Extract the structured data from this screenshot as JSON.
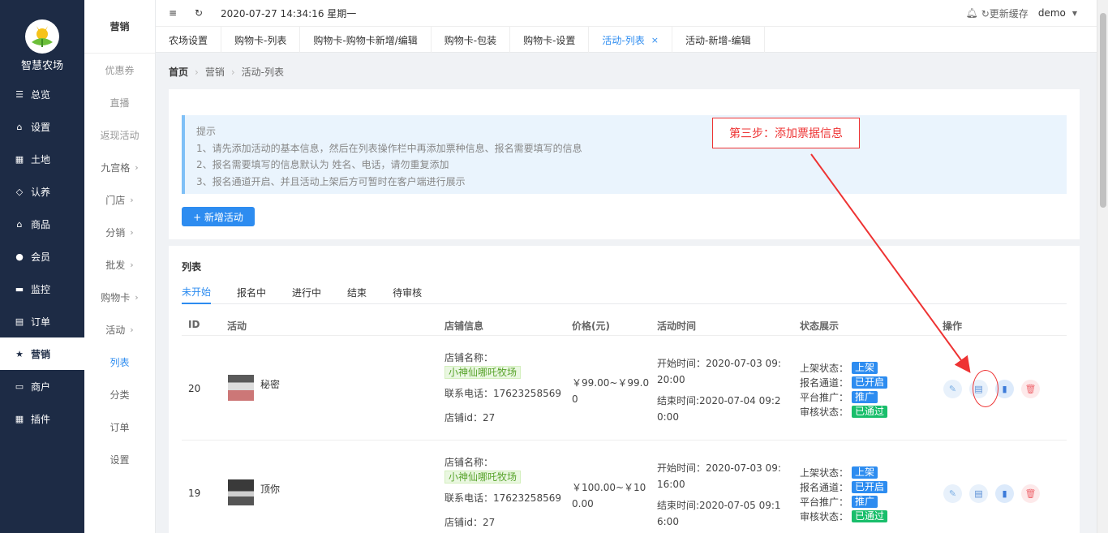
{
  "app": {
    "name": "智慧农场"
  },
  "sidebar": {
    "items": [
      {
        "label": "总览",
        "icon": "sliders-icon"
      },
      {
        "label": "设置",
        "icon": "bag-icon"
      },
      {
        "label": "土地",
        "icon": "grid-icon"
      },
      {
        "label": "认养",
        "icon": "diamond-icon"
      },
      {
        "label": "商品",
        "icon": "bag-icon"
      },
      {
        "label": "会员",
        "icon": "user-icon"
      },
      {
        "label": "监控",
        "icon": "camera-icon"
      },
      {
        "label": "订单",
        "icon": "clipboard-icon"
      },
      {
        "label": "营销",
        "icon": "star-icon",
        "active": true
      },
      {
        "label": "商户",
        "icon": "store-icon"
      },
      {
        "label": "插件",
        "icon": "grid-icon"
      }
    ]
  },
  "submenu": {
    "title": "营销",
    "items": [
      {
        "label": "优惠券",
        "muted": true
      },
      {
        "label": "直播",
        "muted": true
      },
      {
        "label": "返现活动",
        "muted": true
      },
      {
        "label": "九宫格",
        "arrow": true
      },
      {
        "label": "门店",
        "arrow": true
      },
      {
        "label": "分销",
        "arrow": true
      },
      {
        "label": "批发",
        "arrow": true
      },
      {
        "label": "购物卡",
        "arrow": true
      },
      {
        "label": "活动",
        "arrow": true
      },
      {
        "label": "列表",
        "active": true
      },
      {
        "label": "分类"
      },
      {
        "label": "订单"
      },
      {
        "label": "设置"
      }
    ]
  },
  "header": {
    "datetime": "2020-07-27 14:34:16 星期一",
    "refresh_cache": "更新缓存",
    "user": "demo"
  },
  "tabs": [
    {
      "label": "农场设置"
    },
    {
      "label": "购物卡-列表"
    },
    {
      "label": "购物卡-购物卡新增/编辑"
    },
    {
      "label": "购物卡-包装"
    },
    {
      "label": "购物卡-设置"
    },
    {
      "label": "活动-列表",
      "active": true,
      "close": "×"
    },
    {
      "label": "活动-新增-编辑"
    }
  ],
  "breadcrumb": {
    "home": "首页",
    "level1": "营销",
    "level2": "活动-列表"
  },
  "tip": {
    "title": "提示",
    "lines": [
      "1、请先添加活动的基本信息，然后在列表操作栏中再添加票种信息、报名需要填写的信息",
      "2、报名需要填写的信息默认为 姓名、电话，请勿重复添加",
      "3、报名通道开启、并且活动上架后方可暂时在客户端进行展示"
    ]
  },
  "add_button": "+ 新增活动",
  "annotation": "第三步：添加票据信息",
  "list": {
    "title": "列表",
    "status_tabs": [
      "未开始",
      "报名中",
      "进行中",
      "结束",
      "待审核"
    ],
    "columns": [
      "ID",
      "活动",
      "店铺信息",
      "价格(元)",
      "活动时间",
      "状态展示",
      "操作"
    ],
    "rows": [
      {
        "id": "20",
        "name": "秘密",
        "shop_name_label": "店铺名称：",
        "shop_name": "小神仙哪吒牧场",
        "phone": "联系电话：17623258569",
        "shop_id": "店铺id：27",
        "price": "￥99.00~￥99.00",
        "start": "开始时间：2020-07-03 09:20:00",
        "end": "结束时间:2020-07-04 09:20:00",
        "status": [
          {
            "label": "上架状态：",
            "value": "上架",
            "color": "#2d8cf0"
          },
          {
            "label": "报名通道：",
            "value": "已开启",
            "color": "#2d8cf0"
          },
          {
            "label": "平台推广：",
            "value": "推广",
            "color": "#2d8cf0"
          },
          {
            "label": "审核状态：",
            "value": "已通过",
            "color": "#19be6b"
          }
        ]
      },
      {
        "id": "19",
        "name": "顶你",
        "shop_name_label": "店铺名称：",
        "shop_name": "小神仙哪吒牧场",
        "phone": "联系电话：17623258569",
        "shop_id": "店铺id：27",
        "price": "￥100.00~￥100.00",
        "start": "开始时间：2020-07-03 09:16:00",
        "end": "结束时间:2020-07-05 09:16:00",
        "status": [
          {
            "label": "上架状态：",
            "value": "上架",
            "color": "#2d8cf0"
          },
          {
            "label": "报名通道：",
            "value": "已开启",
            "color": "#2d8cf0"
          },
          {
            "label": "平台推广：",
            "value": "推广",
            "color": "#2d8cf0"
          },
          {
            "label": "审核状态：",
            "value": "已通过",
            "color": "#19be6b"
          }
        ]
      }
    ]
  }
}
